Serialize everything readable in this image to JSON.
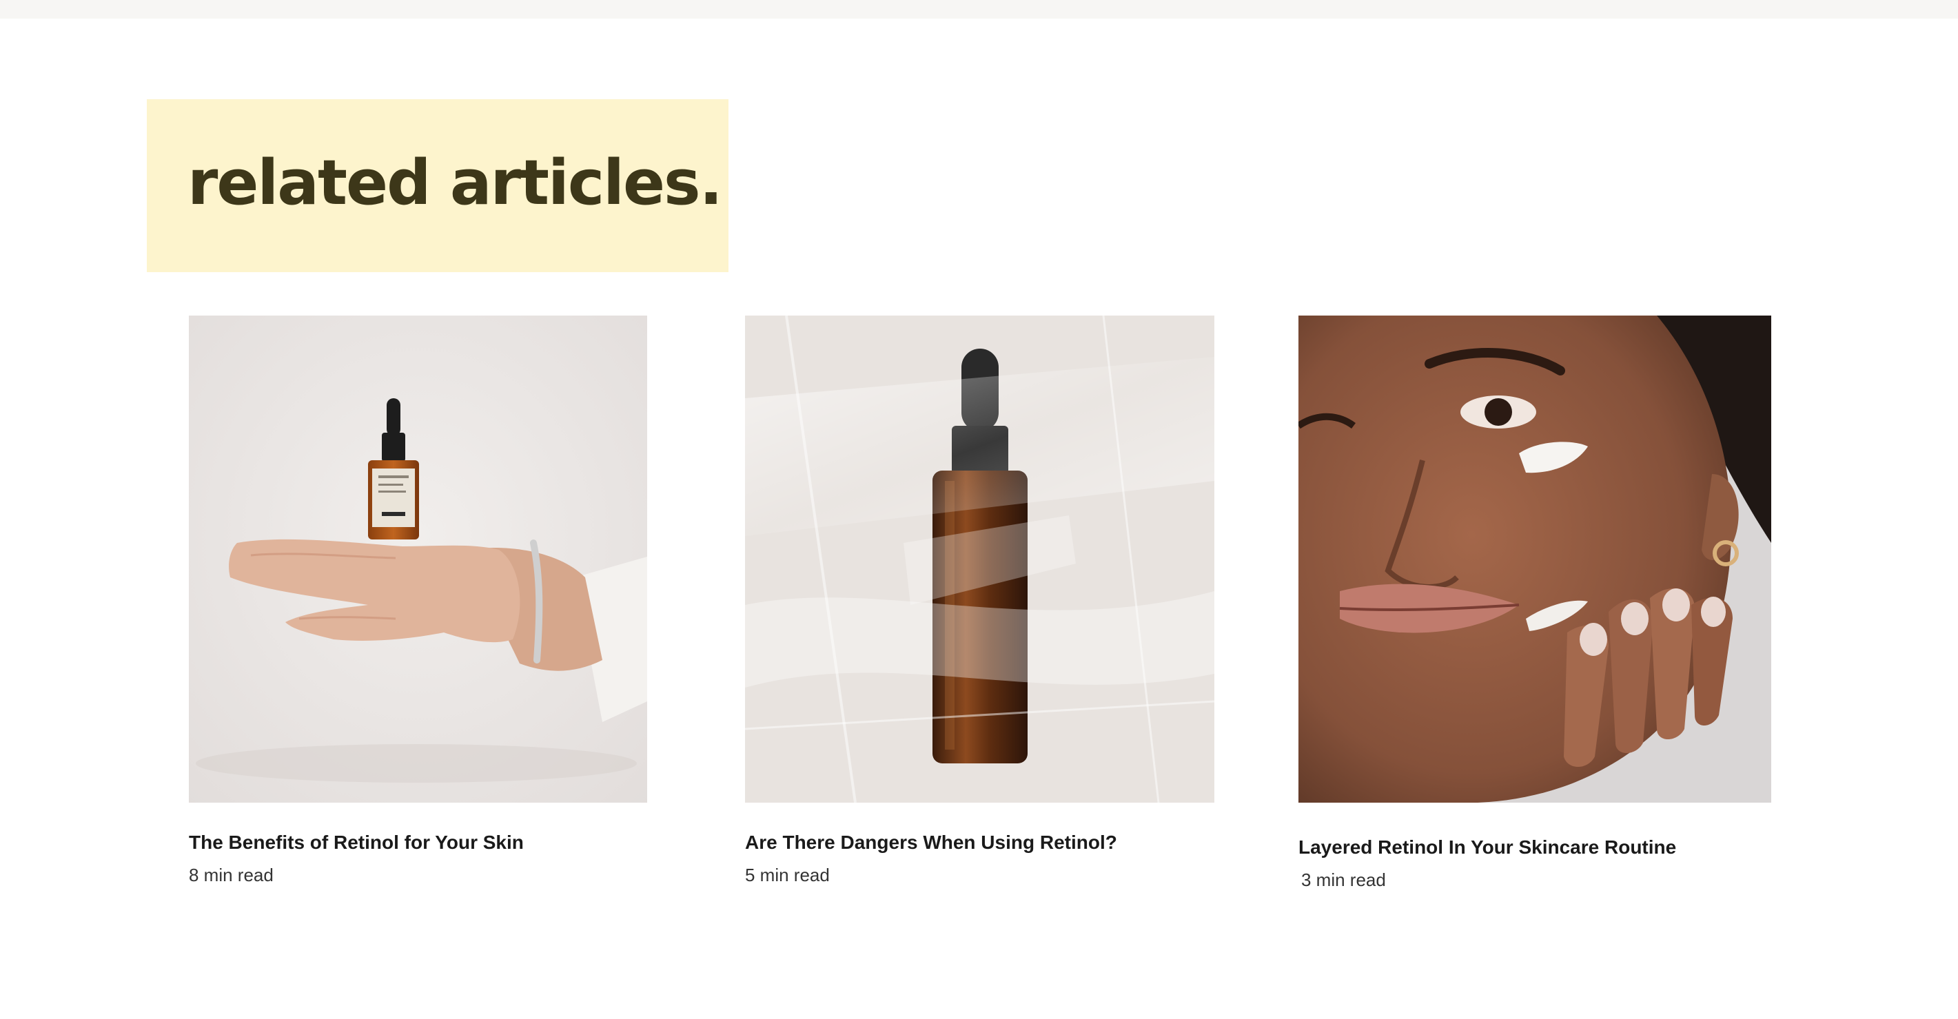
{
  "section": {
    "heading": "related articles."
  },
  "articles": [
    {
      "title": "The Benefits of Retinol for Your Skin",
      "read_time": "8 min read",
      "image": "serum-bottle-on-hand"
    },
    {
      "title": "Are There Dangers When Using Retinol?",
      "read_time": "5 min read",
      "image": "dropper-bottle-in-plastic"
    },
    {
      "title": "Layered Retinol In Your Skincare Routine",
      "read_time": "3 min read",
      "image": "woman-applying-cream"
    }
  ],
  "colors": {
    "heading_bg": "#fdf4cd",
    "heading_text": "#3d3719",
    "title_text": "#1a1a1a"
  }
}
